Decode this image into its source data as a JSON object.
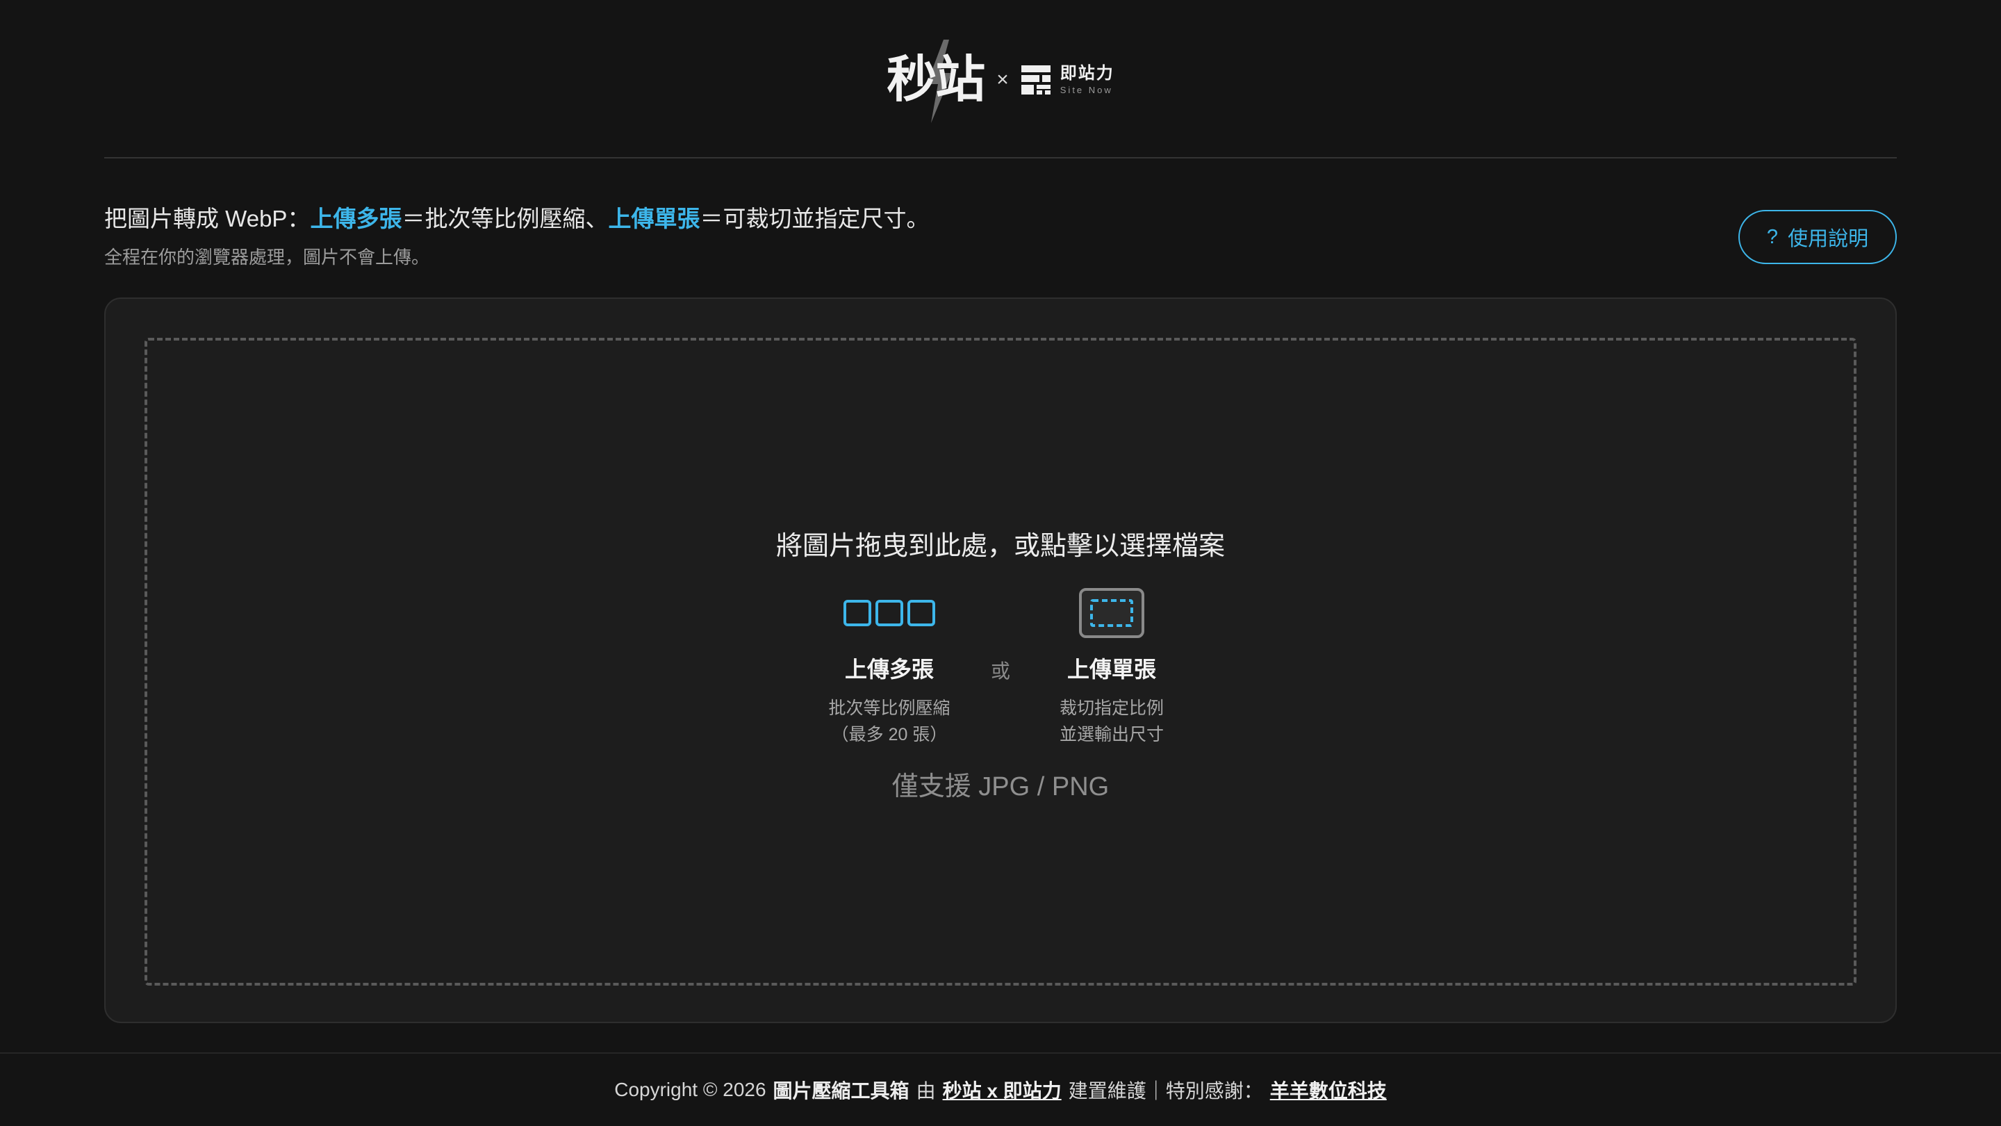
{
  "header": {
    "logo_main": "秒站",
    "logo_separator": "×",
    "logo_partner_cn": "即站力",
    "logo_partner_en": "Site Now"
  },
  "intro": {
    "prefix": "把圖片轉成 WebP：",
    "multi_label": "上傳多張",
    "multi_desc": "＝批次等比例壓縮、",
    "single_label": "上傳單張",
    "single_desc": "＝可裁切並指定尺寸。",
    "subtitle": "全程在你的瀏覽器處理，圖片不會上傳。"
  },
  "help_button": {
    "icon": "?",
    "label": "使用說明"
  },
  "dropzone": {
    "title": "將圖片拖曳到此處，或點擊以選擇檔案",
    "separator": "或",
    "support_text": "僅支援 JPG / PNG",
    "modes": [
      {
        "icon": "three-squares-icon",
        "title": "上傳多張",
        "desc_line1": "批次等比例壓縮",
        "desc_line2": "（最多 20 張）"
      },
      {
        "icon": "crop-frame-icon",
        "title": "上傳單張",
        "desc_line1": "裁切指定比例",
        "desc_line2": "並選輸出尺寸"
      }
    ]
  },
  "footer": {
    "copyright": "Copyright © 2026",
    "app_name": "圖片壓縮工具箱",
    "by": "由",
    "maker_link": "秒站 x 即站力",
    "maintained": "建置維護｜特別感謝：",
    "thanks_link": "羊羊數位科技"
  },
  "colors": {
    "background": "#141414",
    "panel": "#1d1d1d",
    "accent": "#3db6ea",
    "dashed_border": "#5a5a5a"
  }
}
